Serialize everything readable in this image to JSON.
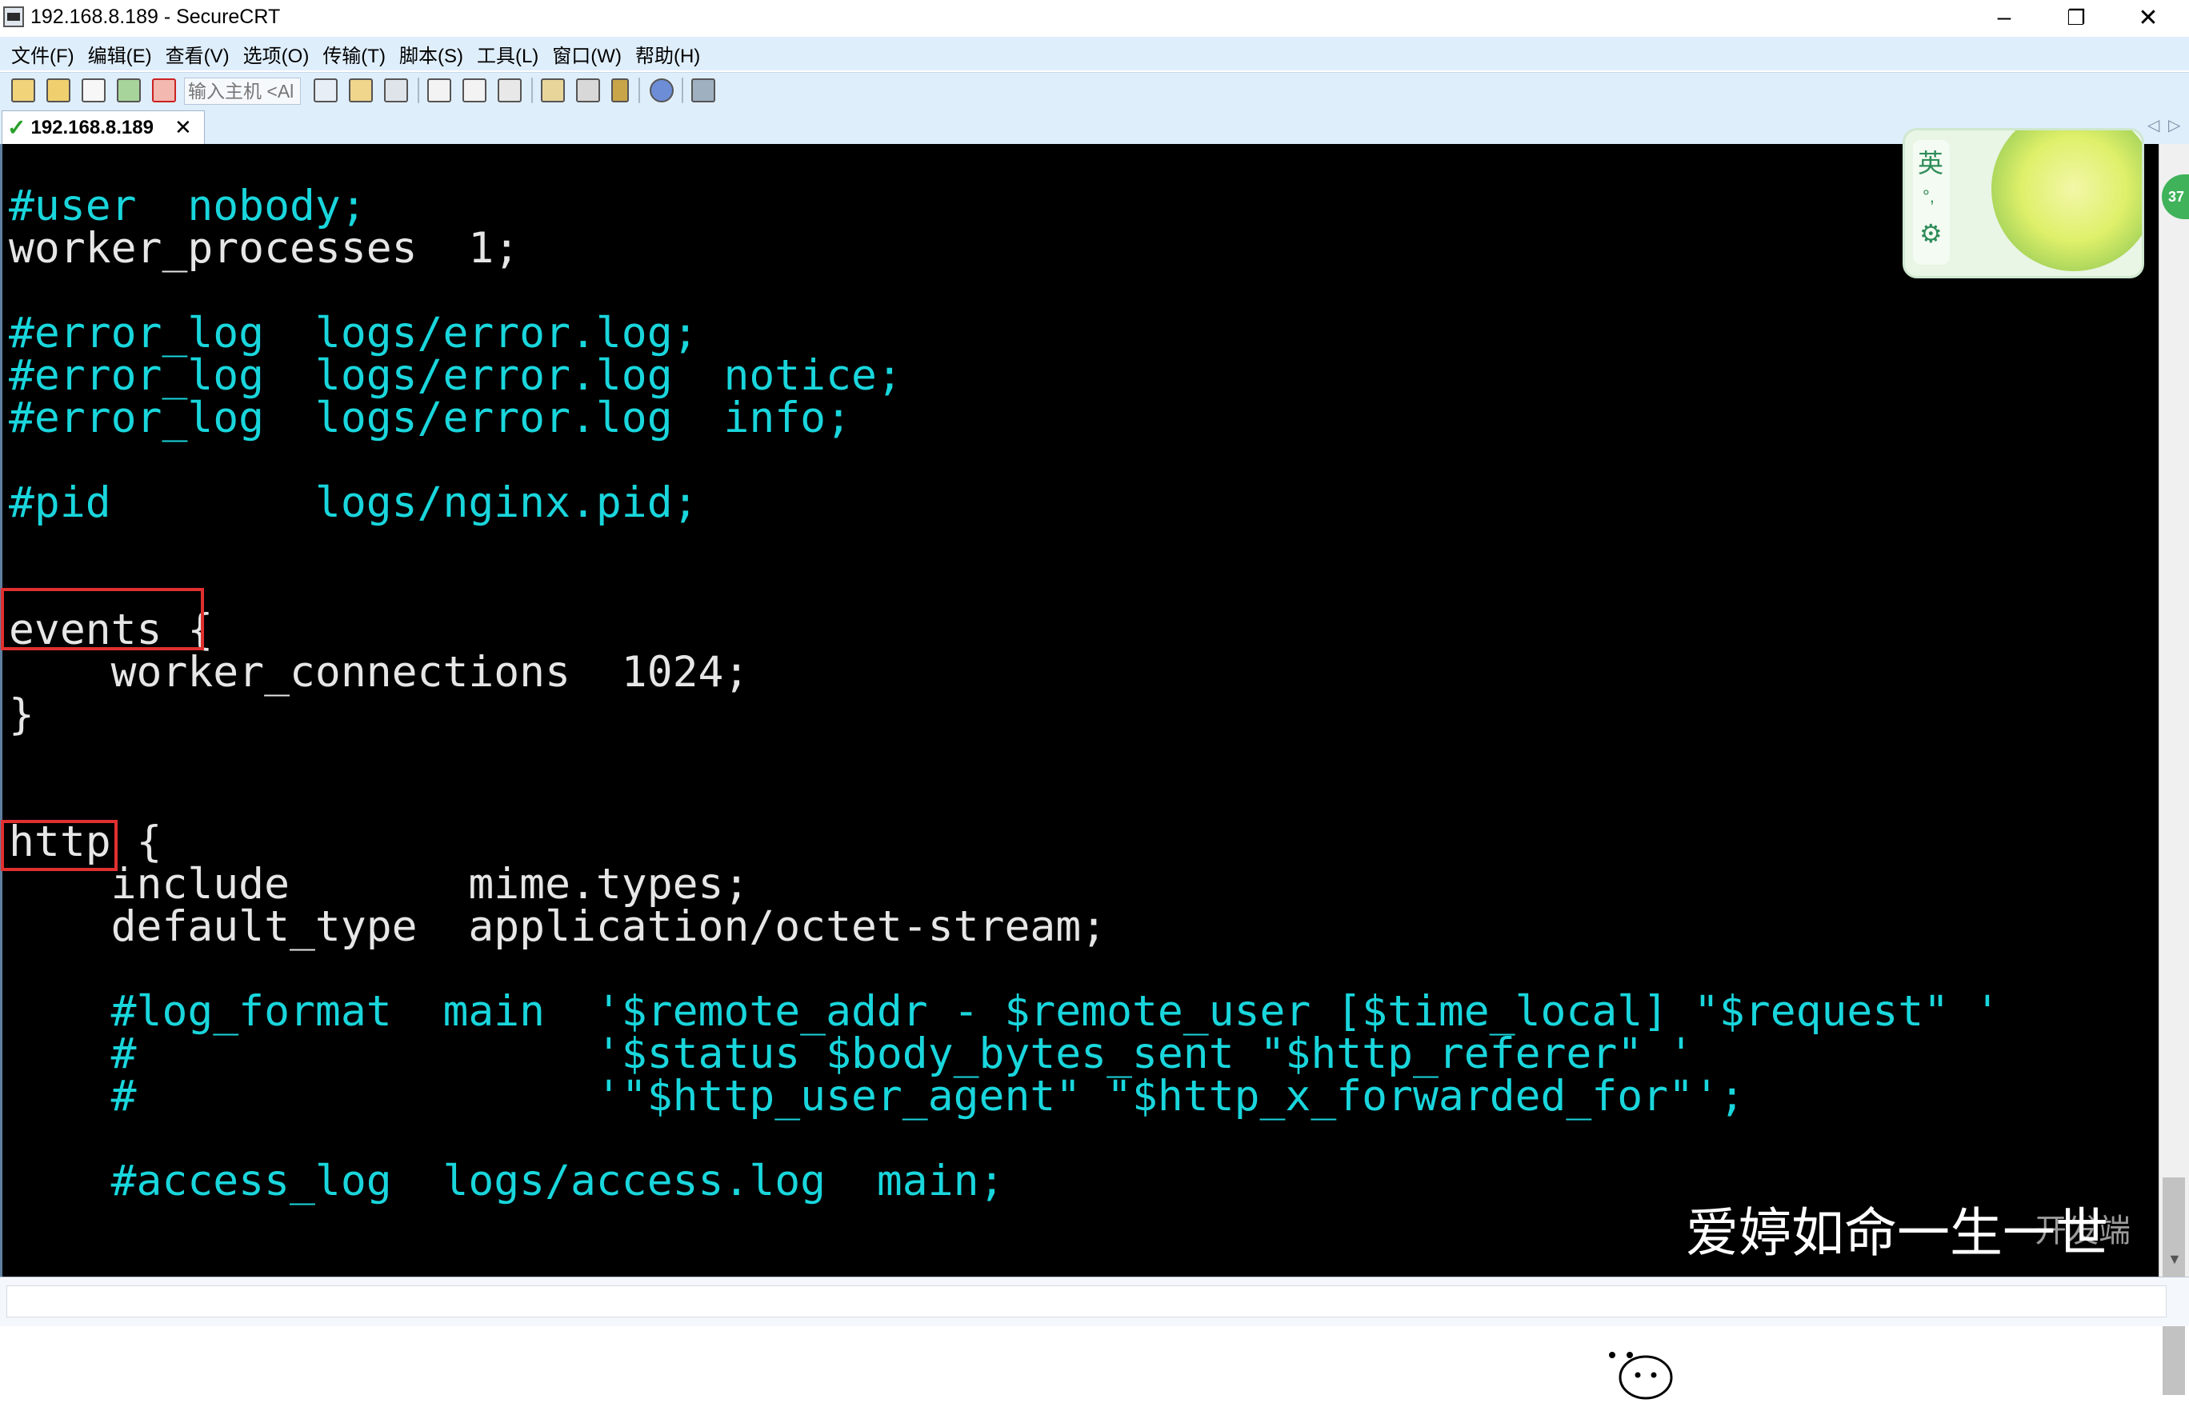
{
  "window": {
    "title": "192.168.8.189 - SecureCRT",
    "minimize": "–",
    "restore": "❐",
    "close": "✕"
  },
  "menu": [
    "文件(F)",
    "编辑(E)",
    "查看(V)",
    "选项(O)",
    "传输(T)",
    "脚本(S)",
    "工具(L)",
    "窗口(W)",
    "帮助(H)"
  ],
  "toolbar": {
    "host_placeholder": "输入主机 <Al",
    "icons": [
      "connect-icon",
      "quick-connect-icon",
      "connect-tab-icon",
      "reconnect-icon",
      "disconnect-icon",
      "copy-icon",
      "paste-icon",
      "find-icon",
      "print-icon",
      "print-screen-icon",
      "print-setup-icon",
      "session-options-icon",
      "global-options-icon",
      "keymap-icon",
      "help-icon",
      "sftp-icon"
    ]
  },
  "tabs": [
    {
      "label": "192.168.8.189",
      "status": "connected",
      "close": "✕"
    }
  ],
  "tab_nav": {
    "left": "◁",
    "right": "▷"
  },
  "terminal": {
    "lines": [
      {
        "text": "#user  nobody;",
        "color": "cyan"
      },
      {
        "text": "worker_processes  1;",
        "color": "white"
      },
      {
        "text": "",
        "color": "white"
      },
      {
        "text": "#error_log  logs/error.log;",
        "color": "cyan"
      },
      {
        "text": "#error_log  logs/error.log  notice;",
        "color": "cyan"
      },
      {
        "text": "#error_log  logs/error.log  info;",
        "color": "cyan"
      },
      {
        "text": "",
        "color": "white"
      },
      {
        "text": "#pid        logs/nginx.pid;",
        "color": "cyan"
      },
      {
        "text": "",
        "color": "white"
      },
      {
        "text": "",
        "color": "white"
      },
      {
        "text": "events {",
        "color": "white"
      },
      {
        "text": "    worker_connections  1024;",
        "color": "white"
      },
      {
        "text": "}",
        "color": "white"
      },
      {
        "text": "",
        "color": "white"
      },
      {
        "text": "",
        "color": "white"
      },
      {
        "text": "http {",
        "color": "white"
      },
      {
        "text": "    include       mime.types;",
        "color": "white"
      },
      {
        "text": "    default_type  application/octet-stream;",
        "color": "white"
      },
      {
        "text": "",
        "color": "white"
      },
      {
        "text": "    #log_format  main  '$remote_addr - $remote_user [$time_local] \"$request\" '",
        "color": "cyan"
      },
      {
        "text": "    #                  '$status $body_bytes_sent \"$http_referer\" '",
        "color": "cyan"
      },
      {
        "text": "    #                  '\"$http_user_agent\" \"$http_x_forwarded_for\"';",
        "color": "cyan"
      },
      {
        "text": "",
        "color": "white"
      },
      {
        "text": "    #access_log  logs/access.log  main;",
        "color": "cyan"
      }
    ],
    "highlights": [
      "events {",
      "http"
    ]
  },
  "ime": {
    "mode": "英",
    "dots": "°,",
    "settings": "⚙"
  },
  "badge": "37",
  "watermark": {
    "text": "爱婷如命一生一世",
    "sub": "开发端"
  },
  "colors": {
    "cyan": "#19d6dc",
    "white": "#e6e6e6",
    "highlight": "#e03030",
    "menubar": "#dfeefb"
  }
}
